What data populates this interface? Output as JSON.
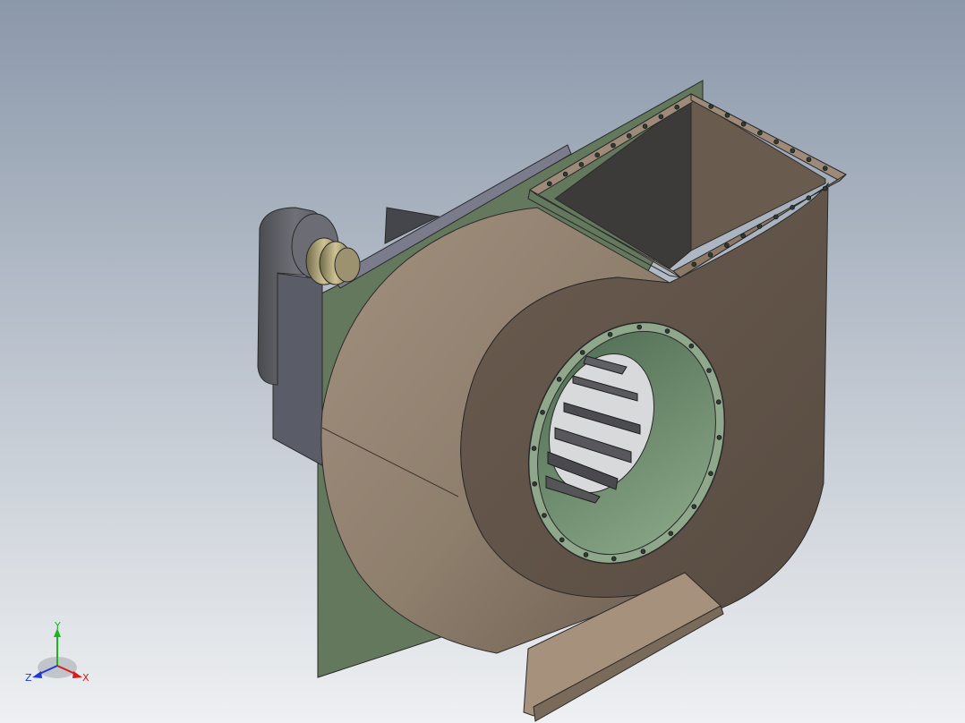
{
  "viewport": {
    "background_top": "#8b98aa",
    "background_bottom": "#eef0f2"
  },
  "model": {
    "housing_color": "#8f7e6c",
    "housing_dark": "#5f5246",
    "side_plate_color": "#63785c",
    "inlet_ring_color": "#7d9a7c",
    "motor_color": "#5c5d63",
    "coupling_color": "#b9ad7a"
  },
  "triad": {
    "x_label": "X",
    "y_label": "Y",
    "z_label": "Z",
    "x_color": "#d21e1e",
    "y_color": "#1eb41e",
    "z_color": "#1e3cd2"
  }
}
